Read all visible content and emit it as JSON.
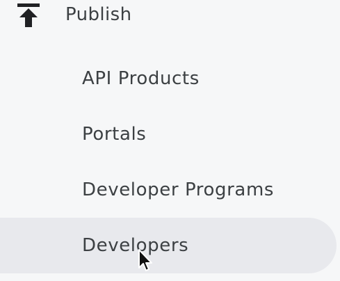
{
  "section": {
    "icon": "publish-upload-icon",
    "label": "Publish"
  },
  "items": [
    {
      "label": "API Products",
      "active": false
    },
    {
      "label": "Portals",
      "active": false
    },
    {
      "label": "Developer Programs",
      "active": false
    },
    {
      "label": "Developers",
      "active": true
    }
  ],
  "colors": {
    "background": "#f6f7f8",
    "active_background": "#e8e9ed",
    "text": "#3c4043",
    "icon": "#202124"
  }
}
